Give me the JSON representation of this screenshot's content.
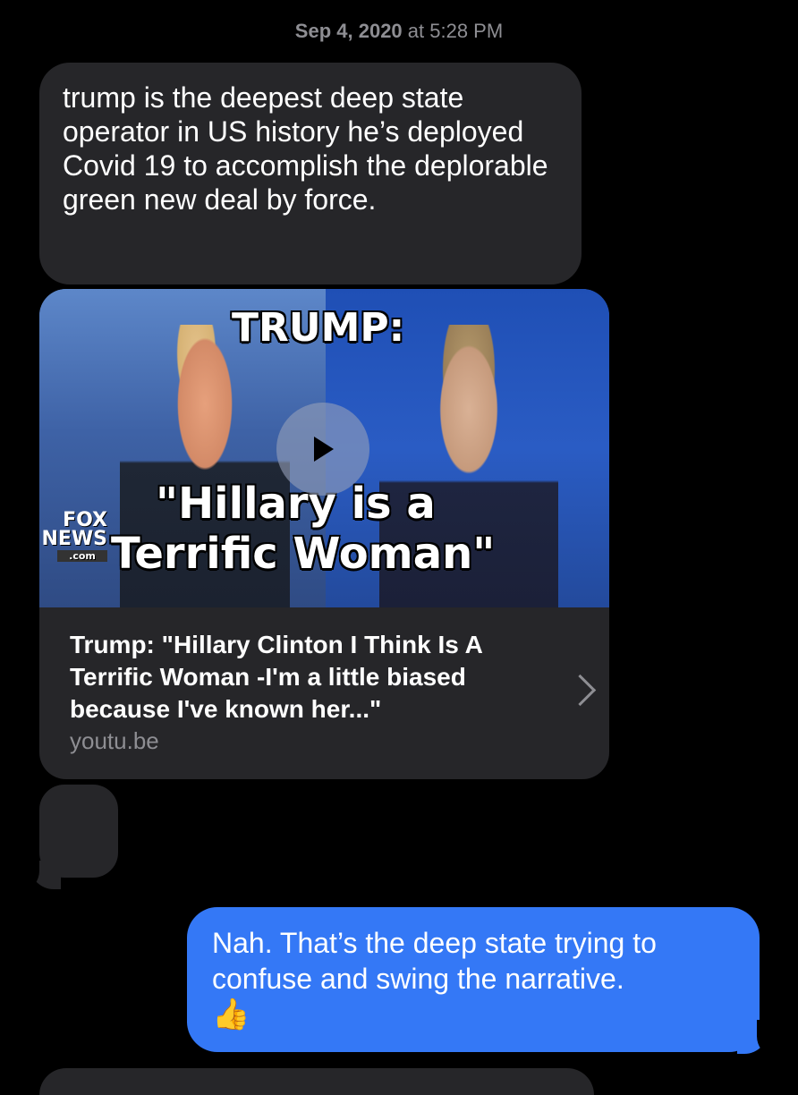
{
  "header": {
    "date": "Sep 4, 2020",
    "time_sep": " at ",
    "time": "5:28 PM"
  },
  "messages": {
    "incoming_1": {
      "text": "trump is the deepest deep state operator in US history he’s deployed Covid 19 to accomplish the deplorable green new deal by force."
    },
    "link_preview": {
      "thumbnail_text": {
        "title": "TRUMP:",
        "line2": "\"Hillary is a",
        "line3": "Terrific Woman\"",
        "logo_line1": "FOX",
        "logo_line2": "NEWS",
        "logo_line3": ".com"
      },
      "title": "Trump: \"Hillary Clinton I Think Is A Terrific Woman -I'm a little biased because I've known her...\"",
      "domain": "youtu.be"
    },
    "outgoing_1": {
      "text": "Nah. That’s the deep state trying to confuse and swing the narrative.",
      "emoji": "👍"
    }
  },
  "colors": {
    "background": "#000000",
    "incoming_bubble": "#262629",
    "outgoing_bubble": "#3478f6",
    "meta_text": "#8e8e93"
  },
  "icons": [
    "play-icon",
    "chevron-right-icon",
    "thumbs-up-emoji"
  ]
}
